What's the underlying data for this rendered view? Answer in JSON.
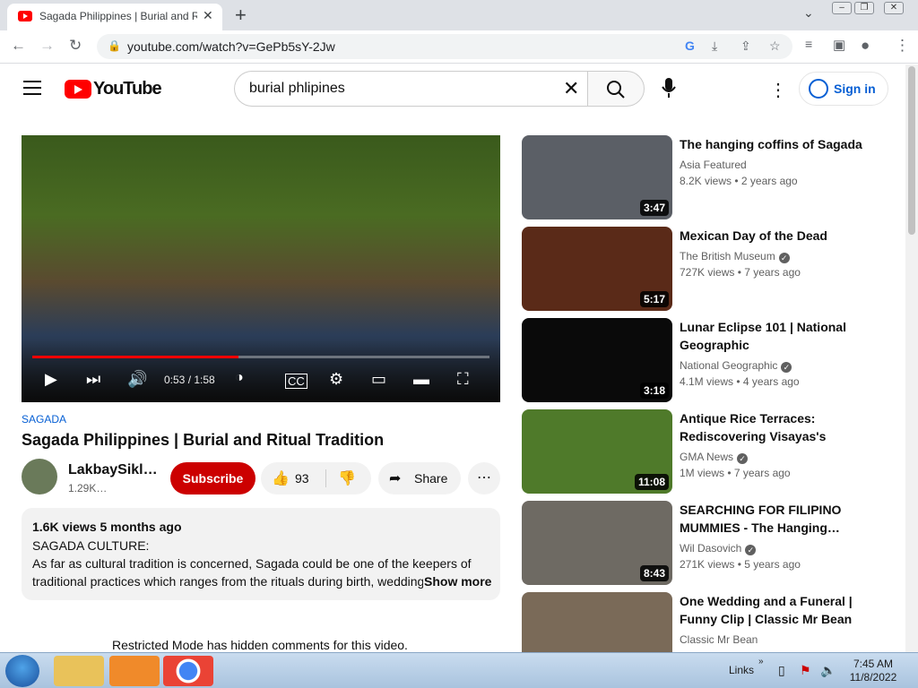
{
  "browser": {
    "tab_title": "Sagada Philippines | Burial and Ritual Tradition - YouTube",
    "new_tab": "+",
    "url": "youtube.com/watch?v=GePb5sY-2Jw"
  },
  "youtube": {
    "logo_text": "YouTube",
    "search_query": "burial phlipines",
    "sign_in": "Sign in"
  },
  "player": {
    "time": "0:53 / 1:58",
    "progress": 0.45
  },
  "video": {
    "tag": "SAGADA",
    "title": "Sagada Philippines | Burial and Ritual Tradition",
    "channel_name": "LakbaySikl…",
    "channel_subs": "1.29K…",
    "subscribe": "Subscribe",
    "likes": "93",
    "share": "Share"
  },
  "description": {
    "meta": "1.6K views  5 months ago",
    "line1": "SAGADA CULTURE:",
    "line2": "As far as cultural tradition is concerned, Sagada could be one of the keepers of",
    "line3": "traditional practices which ranges from the rituals during birth, wedding",
    "show_more": "Show more"
  },
  "restricted_notice": "Restricted Mode has hidden comments for this video.",
  "recommendations": [
    {
      "title": "The hanging coffins of Sagada",
      "channel": "Asia Featured",
      "views": "8.2K views  • 2 years ago",
      "duration": "3:47",
      "verified": false,
      "thumb_color": "#5b5f66"
    },
    {
      "title": "Mexican Day of the Dead",
      "channel": "The British Museum",
      "views": "727K views  • 7 years ago",
      "duration": "5:17",
      "verified": true,
      "thumb_color": "#5a2a18"
    },
    {
      "title": "Lunar Eclipse 101 | National Geographic",
      "channel": "National Geographic",
      "views": "4.1M views  • 4 years ago",
      "duration": "3:18",
      "verified": true,
      "thumb_color": "#0a0a0a"
    },
    {
      "title": "Antique Rice Terraces: Rediscovering Visayas's hidde…",
      "channel": "GMA News",
      "views": "1M views  • 7 years ago",
      "duration": "11:08",
      "verified": true,
      "thumb_color": "#4f7a2a"
    },
    {
      "title": "SEARCHING FOR FILIPINO MUMMIES - The Hanging…",
      "channel": "Wil Dasovich",
      "views": "271K views  • 5 years ago",
      "duration": "8:43",
      "verified": true,
      "thumb_color": "#6e6a63"
    },
    {
      "title": "One Wedding and a Funeral | Funny Clip | Classic Mr Bean",
      "channel": "Classic Mr Bean",
      "views": "",
      "duration": "",
      "verified": false,
      "thumb_color": "#7a6a58"
    }
  ],
  "taskbar": {
    "links": "Links",
    "time": "7:45 AM",
    "date": "11/8/2022"
  }
}
